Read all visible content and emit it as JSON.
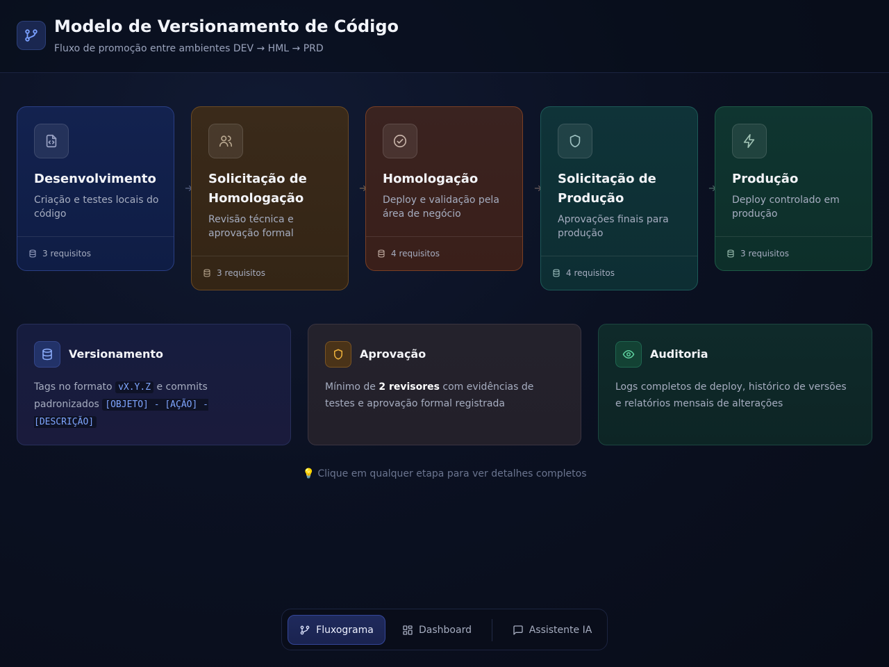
{
  "header": {
    "title": "Modelo de Versionamento de Código",
    "subtitle": "Fluxo de promoção entre ambientes DEV → HML → PRD",
    "logo_icon": "git-branch-icon"
  },
  "stages": [
    {
      "title": "Desenvolvimento",
      "description": "Criação e testes locais do código",
      "requirements": "3 requisitos",
      "icon": "file-code-icon",
      "color": "#3b5bd6"
    },
    {
      "title": "Solicitação de Homologação",
      "description": "Revisão técnica e aprovação formal",
      "requirements": "3 requisitos",
      "icon": "users-icon",
      "color": "#c97a2a"
    },
    {
      "title": "Homologação",
      "description": "Deploy e validação pela área de negócio",
      "requirements": "4 requisitos",
      "icon": "check-circle-icon",
      "color": "#c9562a"
    },
    {
      "title": "Solicitação de Produção",
      "description": "Aprovações finais para produção",
      "requirements": "4 requisitos",
      "icon": "shield-icon",
      "color": "#1f9a8a"
    },
    {
      "title": "Produção",
      "description": "Deploy controlado em produção",
      "requirements": "3 requisitos",
      "icon": "zap-icon",
      "color": "#1f9a6a"
    }
  ],
  "info_cards": {
    "versioning": {
      "title": "Versionamento",
      "body_1": "Tags no formato ",
      "code_1": "vX.Y.Z",
      "body_2": " e commits padronizados ",
      "code_2": "[OBJETO] - [AÇÃO] - [DESCRIÇÃO]",
      "icon": "database-icon"
    },
    "approval": {
      "title": "Aprovação",
      "body_1": "Mínimo de ",
      "strong": "2 revisores",
      "body_2": " com evidências de testes e aprovação formal registrada",
      "icon": "shield-icon"
    },
    "audit": {
      "title": "Auditoria",
      "body": "Logs completos de deploy, histórico de versões e relatórios mensais de alterações",
      "icon": "eye-icon"
    }
  },
  "hint": "💡 Clique em qualquer etapa para ver detalhes completos",
  "nav": {
    "items": [
      {
        "label": "Fluxograma",
        "icon": "git-branch-icon",
        "active": true
      },
      {
        "label": "Dashboard",
        "icon": "layout-grid-icon",
        "active": false
      },
      {
        "label": "Assistente IA",
        "icon": "message-square-icon",
        "active": false
      }
    ]
  }
}
